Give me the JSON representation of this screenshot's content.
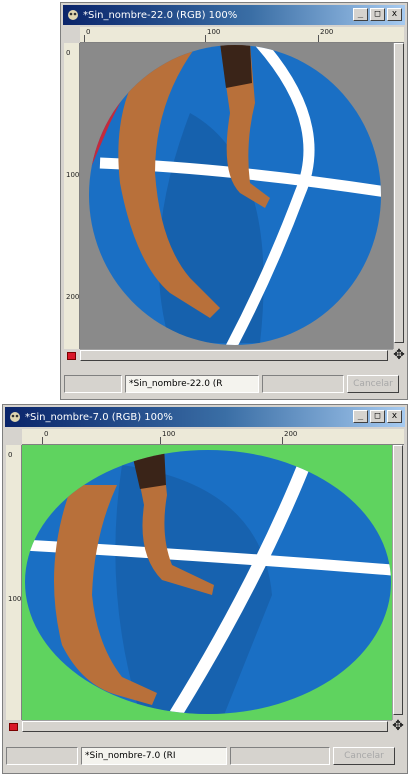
{
  "windows": [
    {
      "title": "*Sin_nombre-22.0 (RGB) 100%",
      "ruler_h": [
        "0",
        "100",
        "200"
      ],
      "ruler_v": [
        "0",
        "100",
        "200"
      ],
      "status_name": "*Sin_nombre-22.0 (R",
      "cancel_label": "Cancelar",
      "canvas_bg": "#8a8a8a"
    },
    {
      "title": "*Sin_nombre-7.0 (RGB) 100%",
      "ruler_h": [
        "0",
        "100",
        "200"
      ],
      "ruler_v": [
        "0",
        "100"
      ],
      "status_name": "*Sin_nombre-7.0 (RI",
      "cancel_label": "Cancelar",
      "canvas_bg": "#5fd35f"
    }
  ],
  "controls": {
    "minimize": "_",
    "maximize": "□",
    "close": "x",
    "navigate": "✥"
  },
  "colors": {
    "titlebar_start": "#0a246a",
    "court_blue": "#1a6fc4",
    "court_line": "#ffffff",
    "skin": "#b8703a"
  }
}
